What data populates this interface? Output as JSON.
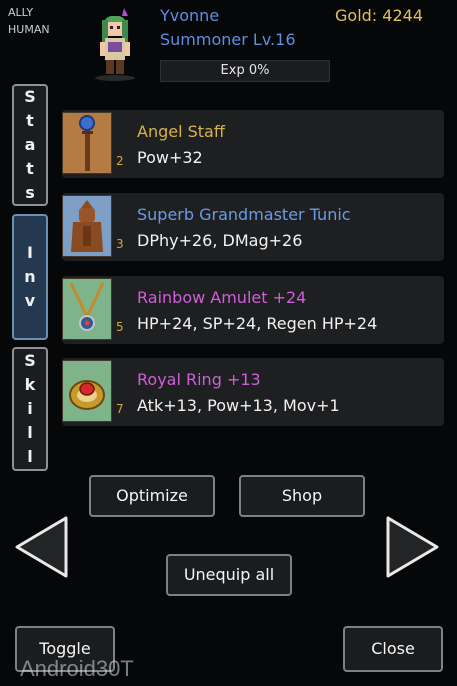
{
  "header": {
    "ally_label": "ALLY",
    "race_label": "HUMAN",
    "character_name": "Yvonne",
    "class_level": "Summoner Lv.16",
    "gold": "Gold: 4244",
    "exp": "Exp 0%"
  },
  "side_tabs": [
    {
      "label": [
        "S",
        "t",
        "a",
        "t",
        "s"
      ],
      "active": false
    },
    {
      "label": [
        "I",
        "n",
        "v"
      ],
      "active": true
    },
    {
      "label": [
        "S",
        "k",
        "i",
        "l",
        "l"
      ],
      "active": false
    }
  ],
  "tab_letters": {
    "stats": [
      "S",
      "t",
      "a",
      "t",
      "s"
    ],
    "inv": [
      "I",
      "n",
      "v"
    ],
    "skill": [
      "S",
      "k",
      "i",
      "l",
      "l"
    ]
  },
  "items": [
    {
      "name": "Angel Staff",
      "stats": "Pow+32",
      "qty": "2",
      "name_color": "#d9b24a",
      "icon": "staff-icon"
    },
    {
      "name": "Superb Grandmaster Tunic",
      "stats": "DPhy+26, DMag+26",
      "qty": "3",
      "name_color": "#6a9be8",
      "icon": "tunic-icon"
    },
    {
      "name": "Rainbow Amulet +24",
      "stats": "HP+24, SP+24, Regen HP+24",
      "qty": "5",
      "name_color": "#cf5fd8",
      "icon": "amulet-icon"
    },
    {
      "name": "Royal Ring +13",
      "stats": "Atk+13, Pow+13, Mov+1",
      "qty": "7",
      "name_color": "#cf5fd8",
      "icon": "ring-icon"
    }
  ],
  "buttons": {
    "optimize": "Optimize",
    "shop": "Shop",
    "unequip_all": "Unequip all",
    "toggle": "Toggle",
    "close": "Close"
  },
  "watermark": "Android30T",
  "colors": {
    "name_blue": "#5d8fe6",
    "gold": "#e1c25a",
    "active_tab": "#24384f"
  }
}
